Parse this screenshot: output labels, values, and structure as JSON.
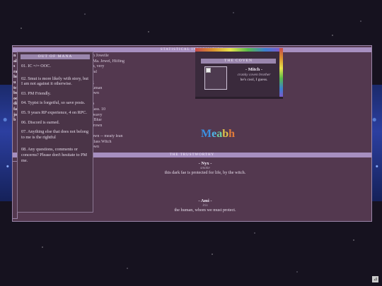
{
  "sections": {
    "statistical": "STATISTICAL INFORMATION",
    "trustworthy": "THE TRUSTWORTHY"
  },
  "left_strip": [
    "n",
    "al",
    "s",
    "ra",
    "ho",
    "u",
    "tc",
    "be",
    "oo",
    "di",
    "fa",
    "jo",
    "b"
  ],
  "stat_lines": [
    "bh Jowelle",
    ", Ma. Jewel, Hiifing",
    "da, very",
    "real",
    "k",
    "ig",
    " human",
    "town",
    "",
    "bs",
    "glass. 10",
    " - wavy",
    "y Blue",
    " Brown",
    "",
    "rown -- meaty lean",
    "-class Witch",
    "town"
  ],
  "out_of_mana": {
    "header": "OUT OF MANA",
    "rules": [
      "01. IC =/= OOC.",
      "02. Smut is more likely with story, but I am not against it otherwise.",
      "03. PM Friendly.",
      "04. Typist is forgetful, so save posts.",
      "05. 9 years RP experience, 4 on RPC.",
      "06. Discord is earned.",
      "07. Anything else that does not belong to me is the rightful",
      "08. Any questions, comments or concerns? Please don't hesitate to PM me."
    ]
  },
  "coven": {
    "header": "THE COVEN",
    "name": "- Mitch -",
    "subtitle": "cranky coven brother",
    "description": "he's cool, I guess."
  },
  "logo": "Meabh",
  "trustworthy": [
    {
      "name": "- Nyx -",
      "subtitle": "smoke",
      "description": "this dark fae is protected for life, by the witch."
    },
    {
      "name": "- Ami -",
      "subtitle": "iris",
      "description": "the human, whom we must protect."
    }
  ],
  "colors": {
    "panel": "#53384f",
    "header_bar": "#a78fc0",
    "background": "#16121f"
  }
}
